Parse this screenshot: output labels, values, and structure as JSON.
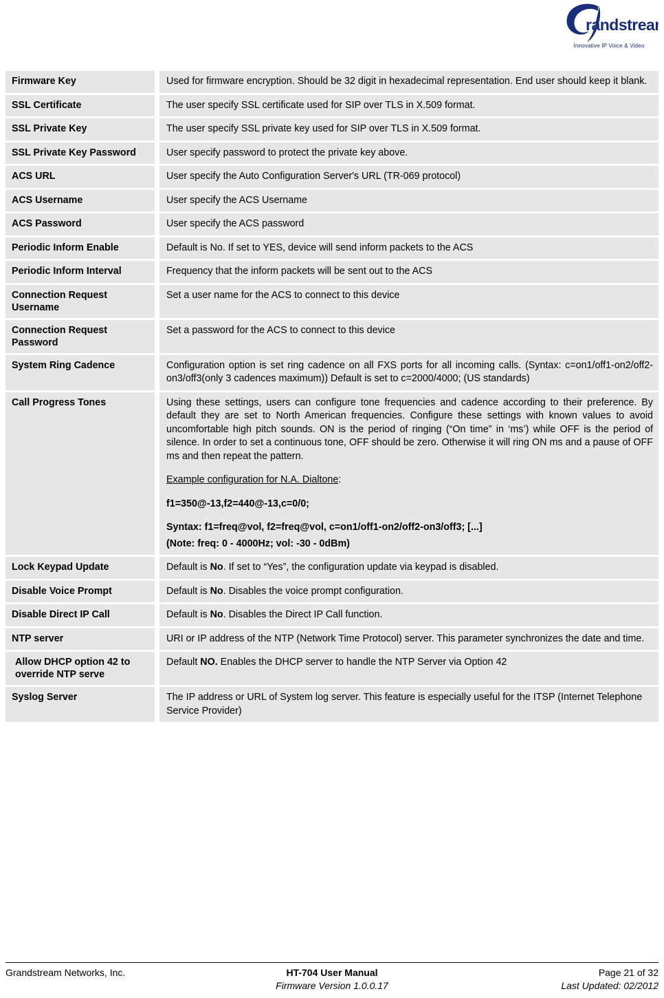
{
  "header": {
    "logo_name": "grandstream-logo",
    "logo_wordmark": "Grandstream",
    "logo_tagline": "Innovative IP Voice & Video",
    "logo_color": "#1a2f7a"
  },
  "table": {
    "background_color": "#e6e6e6",
    "rows": [
      {
        "label": "Firmware Key",
        "desc": "Used for firmware encryption.  Should be 32 digit in hexadecimal representation.  End user should keep it blank."
      },
      {
        "label": "SSL Certificate",
        "desc": "The user specify SSL certificate used for SIP over TLS in X.509 format."
      },
      {
        "label": "SSL Private Key",
        "desc": "The user specify SSL private key used for SIP over TLS in X.509 format."
      },
      {
        "label": "SSL Private Key Password",
        "desc": "User specify password to protect the private key above."
      },
      {
        "label": "ACS URL",
        "desc": "User specify the Auto Configuration Server's URL (TR-069 protocol)"
      },
      {
        "label": "ACS Username",
        "desc": "User specify the ACS Username"
      },
      {
        "label": "ACS Password",
        "desc": "User specify the ACS password"
      },
      {
        "label": "Periodic Inform Enable",
        "desc": "Default is No. If set to YES, device will send inform packets to the ACS"
      },
      {
        "label": "Periodic Inform Interval",
        "desc": "Frequency that the inform packets will be sent out to the ACS"
      },
      {
        "label": "Connection Request Username",
        "desc": "Set a user name for the ACS to connect to this device"
      },
      {
        "label": "Connection Request Password",
        "desc": "Set a password for the ACS to connect to this device"
      },
      {
        "label": "System Ring Cadence",
        "desc": "Configuration option is set ring cadence on all FXS ports for all incoming calls. (Syntax: c=on1/off1-on2/off2-on3/off3(only 3 cadences maximum)) Default is set to c=2000/4000; (US standards)"
      },
      {
        "label": "Call Progress Tones",
        "desc_p1": "Using these settings, users can configure tone frequencies and cadence according to their preference. By default they are set to North American frequencies. Configure these settings with known values to avoid uncomfortable high pitch sounds. ON is the period of ringing (“On time” in ‘ms’) while OFF is the period of silence. In order to set a continuous tone, OFF should be zero. Otherwise it will ring ON ms and a pause of OFF ms and then repeat the pattern.",
        "example_label": "Example configuration for N.A. Dialtone",
        "example_colon": ":",
        "code_line_1": "f1=350@-13,f2=440@-13,c=0/0;",
        "code_line_2": "Syntax: f1=freq@vol, f2=freq@vol, c=on1/off1-on2/off2-on3/off3; [...]",
        "code_line_3": "(Note: freq: 0 - 4000Hz; vol: -30 - 0dBm)"
      },
      {
        "label": "Lock Keypad Update",
        "desc_pre": "Default is ",
        "desc_bold": "No",
        "desc_post": ". If set to “Yes”, the configuration update via keypad is disabled."
      },
      {
        "label": "Disable Voice Prompt",
        "desc_pre": "Default is ",
        "desc_bold": "No",
        "desc_post": ". Disables the voice prompt configuration."
      },
      {
        "label": "Disable Direct IP Call",
        "desc_pre": "Default is ",
        "desc_bold": "No",
        "desc_post": ". Disables the Direct IP Call function."
      },
      {
        "label": "NTP server",
        "desc": "URI or IP address of the NTP (Network Time Protocol) server. This parameter synchronizes the date and time."
      },
      {
        "label": "Allow DHCP option 42 to override NTP serve",
        "desc_pre": "Default ",
        "desc_bold": "NO.",
        "desc_post": " Enables the DHCP server to handle the NTP Server via Option 42"
      },
      {
        "label": "Syslog Server",
        "desc": "The IP address or URL of System log server. This feature is especially useful for the ITSP (Internet Telephone Service Provider)"
      }
    ]
  },
  "footer": {
    "company": "Grandstream Networks, Inc.",
    "manual_title": "HT-704 User Manual",
    "firmware_version": "Firmware Version 1.0.0.17",
    "page_number": "Page 21 of 32",
    "last_updated": "Last Updated: 02/2012"
  }
}
